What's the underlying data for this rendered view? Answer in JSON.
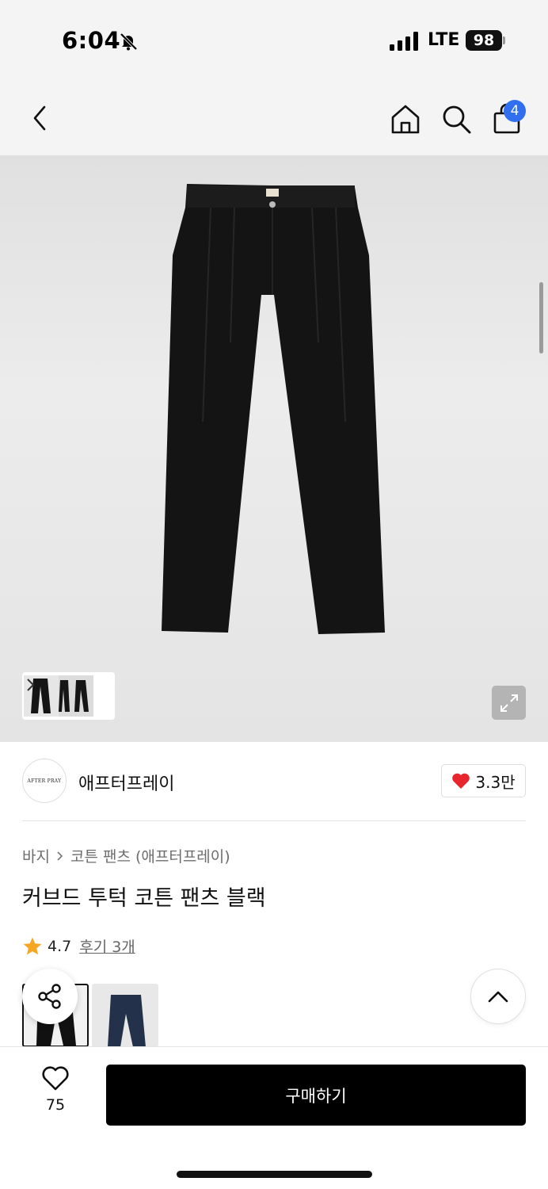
{
  "status_bar": {
    "time": "6:04",
    "network": "LTE",
    "battery": "98",
    "icons": [
      "bell-slash-icon",
      "signal-icon"
    ]
  },
  "nav": {
    "icons": [
      "chevron-left-icon",
      "home-icon",
      "search-icon",
      "shopping-bag-icon"
    ],
    "cart_badge": "4"
  },
  "gallery": {
    "product_color": "#141414",
    "icons": [
      "chevron-right-icon",
      "expand-icon"
    ]
  },
  "brand": {
    "logo_text": "AFTER PRAY",
    "name": "애프터프레이",
    "like_count": "3.3만",
    "heart_color": "#e8262e"
  },
  "product": {
    "breadcrumb": [
      "바지",
      "코튼 팬츠 (애프터프레이)"
    ],
    "title": "커브드 투턱 코튼 팬츠 블랙",
    "rating": "4.7",
    "review_link": "후기 3개",
    "star_color": "#f5a623",
    "swatch_colors": [
      "#111111",
      "#23324a"
    ]
  },
  "actions": {
    "icons": [
      "share-icon",
      "chevron-up-icon",
      "heart-outline-icon"
    ],
    "wish_count": "75",
    "buy_label": "구매하기"
  }
}
